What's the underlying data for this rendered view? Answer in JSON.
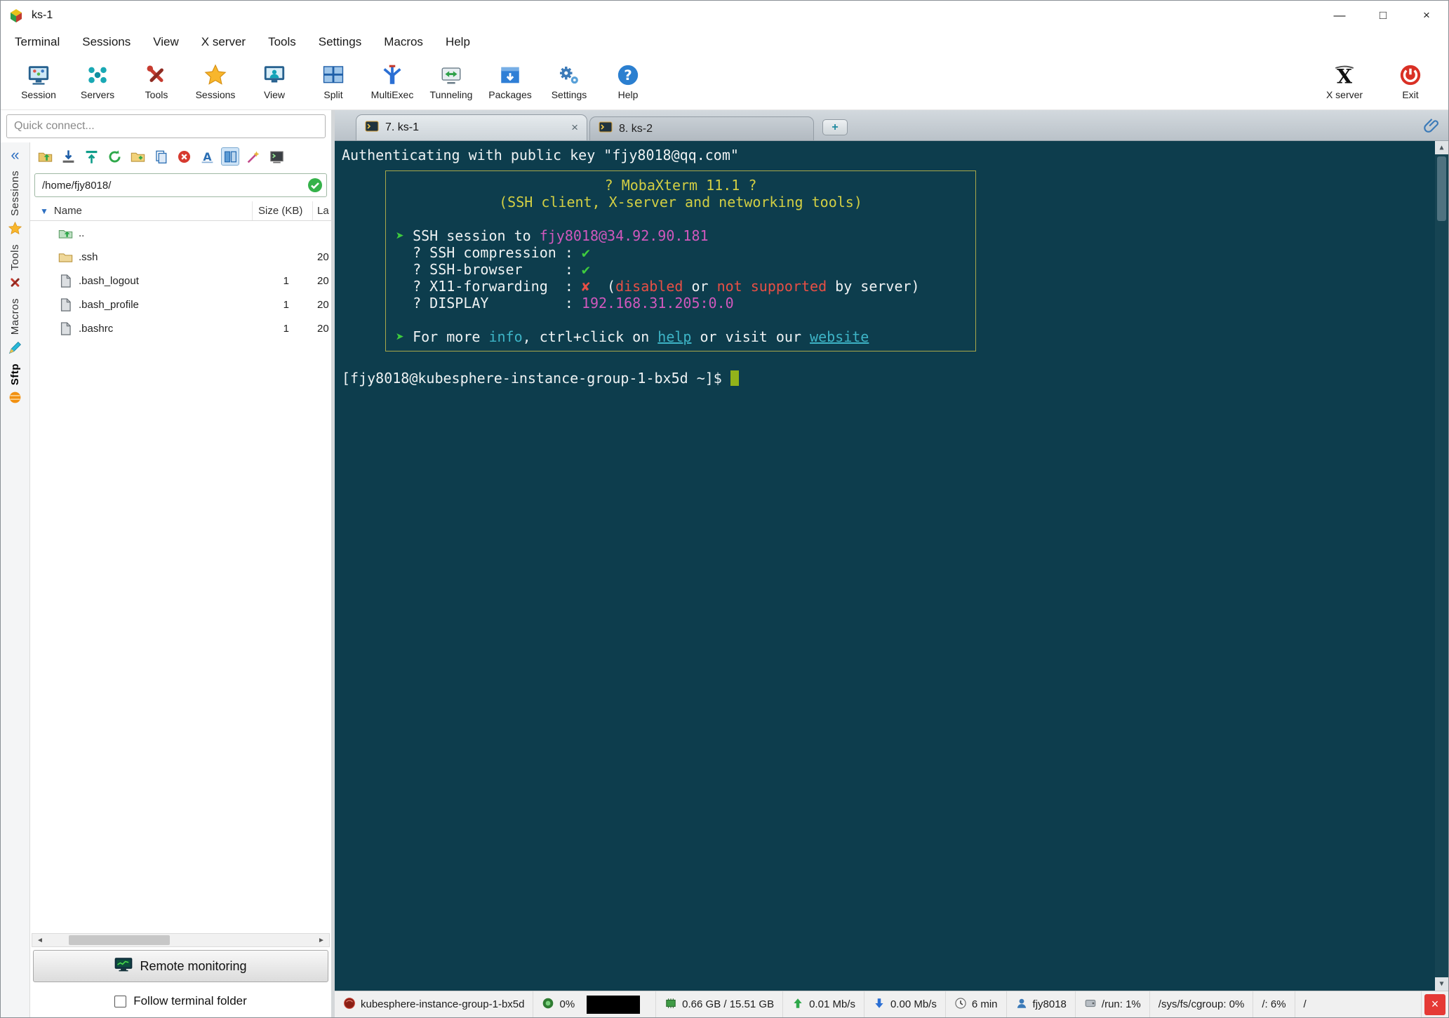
{
  "window": {
    "title": "ks-1",
    "minimize_glyph": "—",
    "maximize_glyph": "□",
    "close_glyph": "×"
  },
  "menu": {
    "items": [
      "Terminal",
      "Sessions",
      "View",
      "X server",
      "Tools",
      "Settings",
      "Macros",
      "Help"
    ]
  },
  "toolbar": {
    "items": [
      "Session",
      "Servers",
      "Tools",
      "Sessions",
      "View",
      "Split",
      "MultiExec",
      "Tunneling",
      "Packages",
      "Settings",
      "Help"
    ],
    "right_items": [
      "X server",
      "Exit"
    ]
  },
  "quick_connect": {
    "placeholder": "Quick connect..."
  },
  "side_tabs": {
    "collapse_glyph": "«",
    "labels": [
      "Sessions",
      "Tools",
      "Macros",
      "Sftp"
    ],
    "active": "Sftp"
  },
  "sftp": {
    "path": "/home/fjy8018/",
    "header_expander_glyph": "▼",
    "columns": [
      "Name",
      "Size (KB)",
      "La"
    ],
    "rows": [
      {
        "name": "..",
        "size": "",
        "modified": ""
      },
      {
        "name": ".ssh",
        "size": "",
        "modified": "20"
      },
      {
        "name": ".bash_logout",
        "size": "1",
        "modified": "20"
      },
      {
        "name": ".bash_profile",
        "size": "1",
        "modified": "20"
      },
      {
        "name": ".bashrc",
        "size": "1",
        "modified": "20"
      }
    ],
    "scroll_left_glyph": "◄",
    "scroll_right_glyph": "►",
    "remote_monitoring_label": "Remote monitoring",
    "follow_terminal_label": "Follow terminal folder"
  },
  "tabs": {
    "items": [
      {
        "label": "7. ks-1"
      },
      {
        "label": "8. ks-2"
      }
    ],
    "close_glyph": "×",
    "new_tab_glyph": "+"
  },
  "terminal": {
    "colors": {
      "bg": "#0d3d4d",
      "fg": "#eef2f3",
      "yellow": "#d3cf43",
      "green": "#3ecb3e",
      "red": "#e84f45",
      "magenta": "#d158bd",
      "cyan": "#3db4c6",
      "border": "#a8a84a",
      "cursor": "#93b31a"
    },
    "term_scroll": {
      "up": "▲",
      "down": "▼"
    },
    "auth_line": [
      [
        "fg",
        "Authenticating with public key \"fjy8018@qq.com\""
      ]
    ],
    "banner_lines": [
      {
        "align": "center",
        "segs": [
          [
            "yellow",
            "? MobaXterm 11.1 ?"
          ]
        ]
      },
      {
        "align": "center",
        "segs": [
          [
            "yellow",
            "(SSH client, X-server and networking tools)"
          ]
        ]
      },
      {
        "segs": []
      },
      {
        "segs": [
          [
            "green",
            "➤ "
          ],
          [
            "fg",
            "SSH session to "
          ],
          [
            "magenta",
            "fjy8018@34.92.90.181"
          ]
        ]
      },
      {
        "segs": [
          [
            "fg",
            "  ? SSH compression : "
          ],
          [
            "green",
            "✔"
          ]
        ]
      },
      {
        "segs": [
          [
            "fg",
            "  ? SSH-browser     : "
          ],
          [
            "green",
            "✔"
          ]
        ]
      },
      {
        "segs": [
          [
            "fg",
            "  ? X11-forwarding  : "
          ],
          [
            "red",
            "✘"
          ],
          [
            "fg",
            "  ("
          ],
          [
            "red",
            "disabled"
          ],
          [
            "fg",
            " or "
          ],
          [
            "red",
            "not supported"
          ],
          [
            "fg",
            " by server)"
          ]
        ]
      },
      {
        "segs": [
          [
            "fg",
            "  ? DISPLAY         : "
          ],
          [
            "magenta",
            "192.168.31.205:0.0"
          ]
        ]
      },
      {
        "segs": []
      },
      {
        "segs": [
          [
            "green",
            "➤ "
          ],
          [
            "fg",
            "For more "
          ],
          [
            "cyan",
            "info"
          ],
          [
            "fg",
            ", ctrl+click on "
          ],
          [
            "cyan-u",
            "help"
          ],
          [
            "fg",
            " or visit our "
          ],
          [
            "cyan-u",
            "website"
          ]
        ]
      }
    ],
    "prompt": [
      [
        "fg",
        "[fjy8018@kubesphere-instance-group-1-bx5d ~]$ "
      ]
    ]
  },
  "status_bar": {
    "host": "kubesphere-instance-group-1-bx5d",
    "cpu": "0%",
    "ram": "0.66 GB / 15.51 GB",
    "upload": "0.01 Mb/s",
    "download": "0.00 Mb/s",
    "uptime": "6 min",
    "user": "fjy8018",
    "disk1": "/run: 1%",
    "disk2": "/sys/fs/cgroup: 0%",
    "disk3": "/: 6%",
    "disk4": "/",
    "close_glyph": "×"
  }
}
